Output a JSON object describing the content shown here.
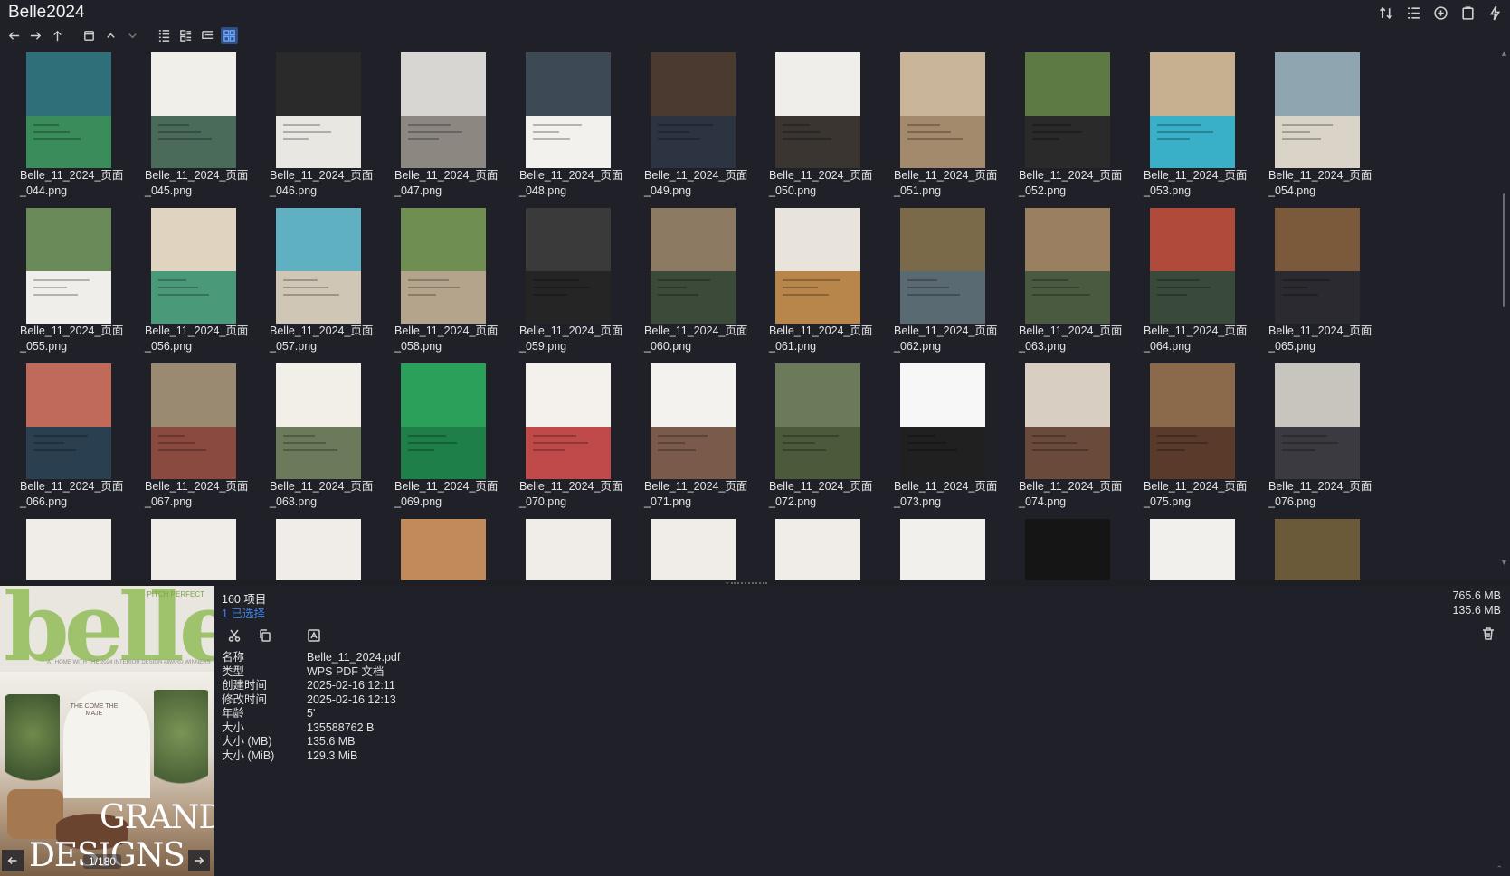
{
  "window": {
    "title": "Belle2024"
  },
  "toolbar_right_icons": [
    "sort-icon",
    "list-details-icon",
    "add-circle-icon",
    "clipboard-icon",
    "bolt-icon"
  ],
  "nav_icons": [
    "back-arrow-icon",
    "forward-arrow-icon",
    "up-arrow-icon",
    "folder-history-icon",
    "chevron-up-icon",
    "chevron-down-icon",
    "view-list-icon",
    "view-details-icon",
    "view-tree-icon",
    "view-grid-icon"
  ],
  "files": [
    {
      "name": "Belle_11_2024_页面\n_044.png",
      "c1": "#2f6f7a",
      "c2": "#3a8c5a"
    },
    {
      "name": "Belle_11_2024_页面\n_045.png",
      "c1": "#f1efea",
      "c2": "#4a6a5a"
    },
    {
      "name": "Belle_11_2024_页面\n_046.png",
      "c1": "#2a2a2a",
      "c2": "#e9e7e2"
    },
    {
      "name": "Belle_11_2024_页面\n_047.png",
      "c1": "#d8d6d2",
      "c2": "#8c8780"
    },
    {
      "name": "Belle_11_2024_页面\n_048.png",
      "c1": "#3d4a56",
      "c2": "#f2f1ee"
    },
    {
      "name": "Belle_11_2024_页面\n_049.png",
      "c1": "#4a3a30",
      "c2": "#2b3440"
    },
    {
      "name": "Belle_11_2024_页面\n_050.png",
      "c1": "#efeeea",
      "c2": "#3a3530"
    },
    {
      "name": "Belle_11_2024_页面\n_051.png",
      "c1": "#c9b59a",
      "c2": "#a48a6c"
    },
    {
      "name": "Belle_11_2024_页面\n_052.png",
      "c1": "#5d7a45",
      "c2": "#2a2a2a"
    },
    {
      "name": "Belle_11_2024_页面\n_053.png",
      "c1": "#c7b08f",
      "c2": "#3ab0c8"
    },
    {
      "name": "Belle_11_2024_页面\n_054.png",
      "c1": "#8fa6b0",
      "c2": "#d9d3c8"
    },
    {
      "name": "Belle_11_2024_页面\n_055.png",
      "c1": "#6a8a5a",
      "c2": "#efeeea"
    },
    {
      "name": "Belle_11_2024_页面\n_056.png",
      "c1": "#e0d4c0",
      "c2": "#4a9a7a"
    },
    {
      "name": "Belle_11_2024_页面\n_057.png",
      "c1": "#5fb0c0",
      "c2": "#cfc6b6"
    },
    {
      "name": "Belle_11_2024_页面\n_058.png",
      "c1": "#6f8f52",
      "c2": "#b5a48c"
    },
    {
      "name": "Belle_11_2024_页面\n_059.png",
      "c1": "#3a3a3a",
      "c2": "#252525"
    },
    {
      "name": "Belle_11_2024_页面\n_060.png",
      "c1": "#8c7a62",
      "c2": "#3c4a3a"
    },
    {
      "name": "Belle_11_2024_页面\n_061.png",
      "c1": "#e8e4dc",
      "c2": "#b8864a"
    },
    {
      "name": "Belle_11_2024_页面\n_062.png",
      "c1": "#7a6a4a",
      "c2": "#5a6a72"
    },
    {
      "name": "Belle_11_2024_页面\n_063.png",
      "c1": "#9a8060",
      "c2": "#4a5a40"
    },
    {
      "name": "Belle_11_2024_页面\n_064.png",
      "c1": "#b04a3a",
      "c2": "#3a4a3a"
    },
    {
      "name": "Belle_11_2024_页面\n_065.png",
      "c1": "#7a5a3a",
      "c2": "#2a2a30"
    },
    {
      "name": "Belle_11_2024_页面\n_066.png",
      "c1": "#c06a5a",
      "c2": "#2a4050"
    },
    {
      "name": "Belle_11_2024_页面\n_067.png",
      "c1": "#9a8a72",
      "c2": "#8a4a40"
    },
    {
      "name": "Belle_11_2024_页面\n_068.png",
      "c1": "#f2efe8",
      "c2": "#6a7a5a"
    },
    {
      "name": "Belle_11_2024_页面\n_069.png",
      "c1": "#2aa05a",
      "c2": "#1e8048"
    },
    {
      "name": "Belle_11_2024_页面\n_070.png",
      "c1": "#f4f1ec",
      "c2": "#c04a4a"
    },
    {
      "name": "Belle_11_2024_页面\n_071.png",
      "c1": "#f4f2ee",
      "c2": "#7a5a4a"
    },
    {
      "name": "Belle_11_2024_页面\n_072.png",
      "c1": "#6a7a5a",
      "c2": "#4a5a3a"
    },
    {
      "name": "Belle_11_2024_页面\n_073.png",
      "c1": "#f7f7f7",
      "c2": "#202020"
    },
    {
      "name": "Belle_11_2024_页面\n_074.png",
      "c1": "#d8cfc2",
      "c2": "#6a4a3a"
    },
    {
      "name": "Belle_11_2024_页面\n_075.png",
      "c1": "#8a6a4a",
      "c2": "#5a3a2a"
    },
    {
      "name": "Belle_11_2024_页面\n_076.png",
      "c1": "#c8c4be",
      "c2": "#3a3a40"
    },
    {
      "name": "",
      "c1": "#f0ede8",
      "c2": "#4a7a8a"
    },
    {
      "name": "",
      "c1": "#f0ede8",
      "c2": "#3a3a3a"
    },
    {
      "name": "",
      "c1": "#f0ede8",
      "c2": "#8a7a6a"
    },
    {
      "name": "",
      "c1": "#c08a5a",
      "c2": "#2a5a4a"
    },
    {
      "name": "",
      "c1": "#f0ede8",
      "c2": "#5a4a3a"
    },
    {
      "name": "",
      "c1": "#f0ede8",
      "c2": "#8a5a3a"
    },
    {
      "name": "",
      "c1": "#f0ede8",
      "c2": "#b09a86"
    },
    {
      "name": "",
      "c1": "#f2f0ec",
      "c2": "#3a5a3a"
    },
    {
      "name": "",
      "c1": "#151515",
      "c2": "#151515"
    },
    {
      "name": "",
      "c1": "#f2f0ec",
      "c2": "#9a8a6a"
    },
    {
      "name": "",
      "c1": "#6a5a3a",
      "c2": "#3a4a2a"
    }
  ],
  "preview": {
    "logo": "belle",
    "pitch_text": "PITCH PERFECT",
    "subtitle": "AT HOME WITH THE 2024 INTERIOR DESIGN AWARD WINNERS",
    "cover_text": "THE COME THE MAJE",
    "headline1": "GRAND",
    "headline2": "DESIGNS",
    "page_counter": "1/180"
  },
  "info": {
    "item_count": "160 项目",
    "selected": "1 已选择",
    "total_size": "765.6 MB",
    "selected_size": "135.6 MB",
    "actions": [
      "cut-icon",
      "copy-icon",
      "rename-icon"
    ],
    "properties": [
      {
        "k": "名称",
        "v": "Belle_11_2024.pdf"
      },
      {
        "k": "类型",
        "v": "WPS PDF 文档"
      },
      {
        "k": "创建时间",
        "v": "2025-02-16  12:11"
      },
      {
        "k": "修改时间",
        "v": "2025-02-16  12:13"
      },
      {
        "k": "年龄",
        "v": "5'"
      },
      {
        "k": "大小",
        "v": "135588762 B"
      },
      {
        "k": "大小 (MB)",
        "v": "135.6 MB"
      },
      {
        "k": "大小 (MiB)",
        "v": "129.3 MiB"
      }
    ]
  }
}
